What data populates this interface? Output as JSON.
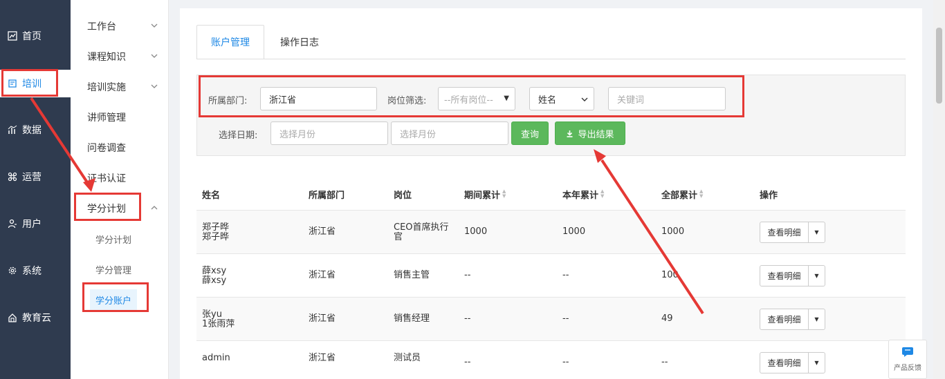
{
  "nav": {
    "items": [
      {
        "label": "首页",
        "icon": "chart-icon"
      },
      {
        "label": "培训",
        "icon": "book-icon"
      },
      {
        "label": "数据",
        "icon": "bar-chart-icon"
      },
      {
        "label": "运营",
        "icon": "command-icon"
      },
      {
        "label": "用户",
        "icon": "user-icon"
      },
      {
        "label": "系统",
        "icon": "gear-icon"
      },
      {
        "label": "教育云",
        "icon": "cloud-icon"
      }
    ]
  },
  "subnav": {
    "items": [
      {
        "label": "工作台"
      },
      {
        "label": "课程知识"
      },
      {
        "label": "培训实施"
      },
      {
        "label": "讲师管理"
      },
      {
        "label": "问卷调查"
      },
      {
        "label": "证书认证"
      },
      {
        "label": "学分计划"
      }
    ],
    "children": [
      {
        "label": "学分计划"
      },
      {
        "label": "学分管理"
      },
      {
        "label": "学分账户"
      }
    ]
  },
  "tabs": [
    {
      "label": "账户管理"
    },
    {
      "label": "操作日志"
    }
  ],
  "filter": {
    "dept_label": "所属部门:",
    "dept_value": "浙江省",
    "post_label": "岗位筛选:",
    "post_value": "--所有岗位--",
    "name_select": "姓名",
    "keyword_placeholder": "关键词",
    "date_label": "选择日期:",
    "month_placeholder_1": "选择月份",
    "month_placeholder_2": "选择月份",
    "query_button": "查询",
    "export_button": "导出结果"
  },
  "table": {
    "headers": [
      "姓名",
      "所属部门",
      "岗位",
      "期间累计",
      "本年累计",
      "全部累计",
      "操作"
    ],
    "rows": [
      {
        "name1": "郑子晔",
        "name2": "郑子晔",
        "dept": "浙江省",
        "post": "CEO首席执行官",
        "period": "1000",
        "year": "1000",
        "total": "1000",
        "action": "查看明细"
      },
      {
        "name1": "薛xsy",
        "name2": "薛xsy",
        "dept": "浙江省",
        "post": "销售主管",
        "period": "--",
        "year": "--",
        "total": "100",
        "action": "查看明细"
      },
      {
        "name1": "张yu",
        "name2": "1张雨萍",
        "dept": "浙江省",
        "post": "销售经理",
        "period": "--",
        "year": "--",
        "total": "49",
        "action": "查看明细"
      },
      {
        "name1": "",
        "name2": "admin",
        "dept": "浙江省",
        "post": "测试员",
        "period": "--",
        "year": "--",
        "total": "--",
        "action": "查看明细"
      }
    ]
  },
  "feedback": {
    "label": "产品反馈"
  },
  "colors": {
    "accent": "#1e88e5",
    "green": "#5cb85c",
    "annotation": "#e53935",
    "nav_bg": "#2f3b4f"
  }
}
